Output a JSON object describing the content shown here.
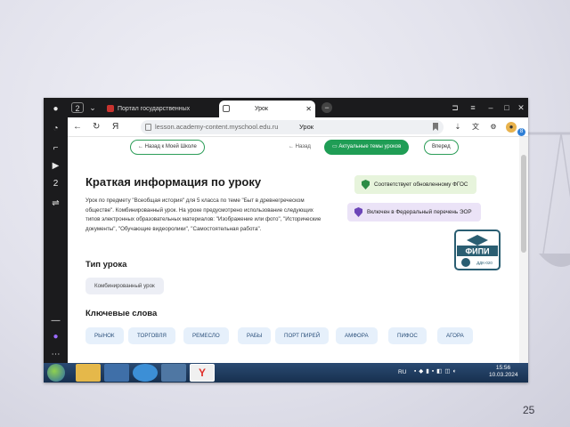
{
  "browser": {
    "tabs": [
      {
        "label": "Портал государственных"
      },
      {
        "label": "Урок",
        "active": true
      }
    ],
    "address": {
      "url": "lesson.academy-content.myschool.edu.ru",
      "title": "Урок"
    }
  },
  "page": {
    "nav": {
      "back_to_menu": "Назад к Моей Школе",
      "prev": "Назад",
      "current": "Актуальные темы уроков",
      "next": "Вперед"
    },
    "heading": "Краткая информация по уроку",
    "summary": "Урок по предмету \"Всеобщая история\" для 5 класса по теме \"Быт в древнегреческом обществе\". Комбинированный урок. На уроке предусмотрено использование следующих типов электронных образовательных материалов: \"Изображение или фото\", \"Исторические документы\", \"Обучающие видеоролики\", \"Самостоятельная работа\".",
    "badges": [
      {
        "label": "Соответствует обновленному ФГОС",
        "color": "#e7f4dc",
        "icon_color": "#2c8c45"
      },
      {
        "label": "Включен в Федеральный перечень ЭОР",
        "color": "#ebe3f7",
        "icon_color": "#6c46b8"
      }
    ],
    "logo": {
      "text": "ФИПИ",
      "sub": "ДДК-020"
    },
    "lesson_type_heading": "Тип урока",
    "lesson_type": "Комбинированный урок",
    "keywords_heading": "Ключевые слова",
    "keywords": [
      "РЫНОК",
      "ТОРГОВЛЯ",
      "РЕМЕСЛО",
      "РАБЫ",
      "ПОРТ ПИРЕЙ",
      "АМФОРА",
      "ПИФОС",
      "АГОРА"
    ]
  },
  "taskbar": {
    "lang": "RU",
    "time": "15:56",
    "date": "10.03.2024"
  },
  "slide_number": "25",
  "colors": {
    "accent": "#1f9d55",
    "keyword_bg": "#e6f0fb",
    "keyword_text": "#2a4f7a"
  }
}
